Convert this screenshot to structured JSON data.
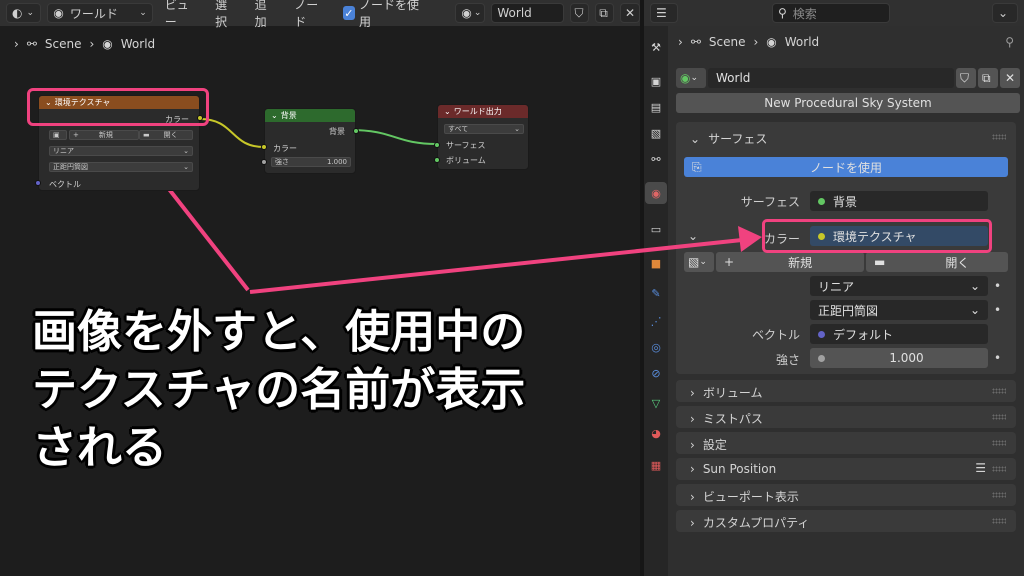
{
  "node_editor": {
    "header": {
      "world_selector": "ワールド",
      "menus": [
        "ビュー",
        "選択",
        "追加",
        "ノード"
      ],
      "use_nodes_label": "ノードを使用",
      "world_name": "World"
    },
    "breadcrumb": {
      "scene": "Scene",
      "world": "World"
    },
    "env_node": {
      "title": "環境テクスチャ",
      "output_color": "カラー",
      "new_label": "新規",
      "open_label": "開く",
      "interpolation": "リニア",
      "projection": "正距円筒図",
      "input_vector": "ベクトル"
    },
    "bg_node": {
      "title": "背景",
      "output_bg": "背景",
      "input_color": "カラー",
      "strength_label": "強さ",
      "strength_value": "1.000"
    },
    "out_node": {
      "title": "ワールド出力",
      "target": "すべて",
      "input_surface": "サーフェス",
      "input_volume": "ボリューム"
    }
  },
  "caption": {
    "line1": "画像を外すと、使用中の",
    "line2": "テクスチャの名前が表示",
    "line3": "される"
  },
  "properties": {
    "search_placeholder": "検索",
    "breadcrumb": {
      "scene": "Scene",
      "world": "World"
    },
    "world_name": "World",
    "procedural_sky_button": "New Procedural Sky System",
    "surface_panel": {
      "title": "サーフェス",
      "use_nodes_button": "ノードを使用",
      "surface_label": "サーフェス",
      "surface_value": "背景",
      "color_label": "カラー",
      "color_value": "環境テクスチャ",
      "new_label": "新規",
      "open_label": "開く",
      "interpolation": "リニア",
      "projection": "正距円筒図",
      "vector_label": "ベクトル",
      "vector_value": "デフォルト",
      "strength_label": "強さ",
      "strength_value": "1.000"
    },
    "collapsed_panels": [
      "ボリューム",
      "ミストパス",
      "設定",
      "Sun Position",
      "ビューポート表示",
      "カスタムプロパティ"
    ]
  },
  "colors": {
    "highlight": "#f0427f",
    "env_node_header": "#8a4d1f",
    "bg_node_header": "#2d6a2d",
    "out_node_header": "#6b2a2a",
    "accent_blue": "#4a82d8"
  }
}
